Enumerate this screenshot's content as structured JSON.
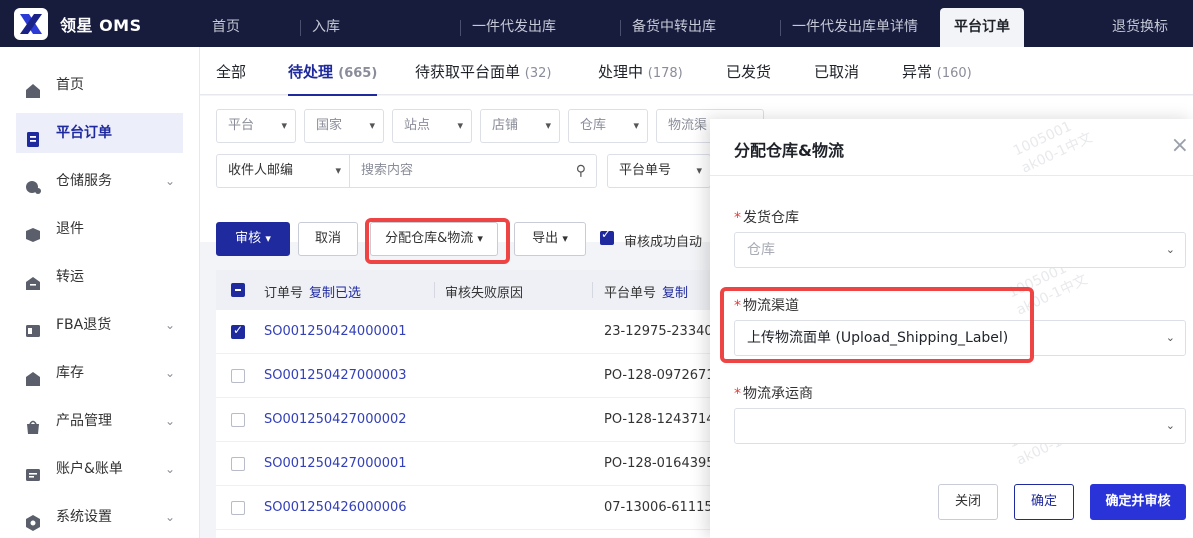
{
  "app": {
    "brand": "领星 OMS"
  },
  "top_tabs": [
    "首页",
    "入库",
    "一件代发出库",
    "备货中转出库",
    "一件代发出库单详情",
    "平台订单",
    "退货换标"
  ],
  "sidebar": {
    "items": [
      {
        "label": "首页",
        "icon": "home-icon"
      },
      {
        "label": "平台订单",
        "icon": "clipboard-icon"
      },
      {
        "label": "仓储服务",
        "icon": "warehouse-icon"
      },
      {
        "label": "退件",
        "icon": "return-icon"
      },
      {
        "label": "转运",
        "icon": "transfer-icon"
      },
      {
        "label": "FBA退货",
        "icon": "fba-icon"
      },
      {
        "label": "库存",
        "icon": "inventory-icon"
      },
      {
        "label": "产品管理",
        "icon": "product-icon"
      },
      {
        "label": "账户&账单",
        "icon": "account-icon"
      },
      {
        "label": "系统设置",
        "icon": "settings-icon"
      }
    ]
  },
  "status_tabs": [
    {
      "label": "全部",
      "count": ""
    },
    {
      "label": "待处理",
      "count": "(665)"
    },
    {
      "label": "待获取平台面单",
      "count": "(32)"
    },
    {
      "label": "处理中",
      "count": "(178)"
    },
    {
      "label": "已发货",
      "count": ""
    },
    {
      "label": "已取消",
      "count": ""
    },
    {
      "label": "异常",
      "count": "(160)"
    }
  ],
  "filters": {
    "platform": "平台",
    "country": "国家",
    "site": "站点",
    "store": "店铺",
    "warehouse": "仓库",
    "logistics": "物流渠",
    "postcode": "收件人邮编",
    "search_placeholder": "搜索内容",
    "platform_order": "平台单号"
  },
  "actions": {
    "review": "审核",
    "cancel": "取消",
    "assign": "分配仓库&物流",
    "export": "导出",
    "auto_label": "审核成功自动"
  },
  "table": {
    "headers": {
      "order_no": "订单号",
      "copy_selected": "复制已选",
      "fail_reason": "审核失败原因",
      "platform_no": "平台单号",
      "copy_short": "复制"
    },
    "rows": [
      {
        "order": "SO001250424000001",
        "platform": "23-12975-23340",
        "checked": true
      },
      {
        "order": "SO001250427000003",
        "platform": "PO-128-0972671",
        "checked": false
      },
      {
        "order": "SO001250427000002",
        "platform": "PO-128-1243714",
        "checked": false
      },
      {
        "order": "SO001250427000001",
        "platform": "PO-128-0164395",
        "checked": false
      },
      {
        "order": "SO001250426000006",
        "platform": "07-13006-61115",
        "checked": false
      }
    ]
  },
  "modal": {
    "title": "分配仓库&物流",
    "warehouse_label": "发货仓库",
    "warehouse_placeholder": "仓库",
    "channel_label": "物流渠道",
    "channel_value": "上传物流面单 (Upload_Shipping_Label)",
    "carrier_label": "物流承运商",
    "carrier_value": "",
    "close_btn": "关闭",
    "confirm_btn": "确定",
    "confirm_review_btn": "确定并审核",
    "watermark_id": "1005001",
    "watermark_user": "ak00-1中文"
  },
  "colors": {
    "primary": "#1f2a9e",
    "highlight": "#ef4444",
    "topbar": "#171b3c"
  }
}
